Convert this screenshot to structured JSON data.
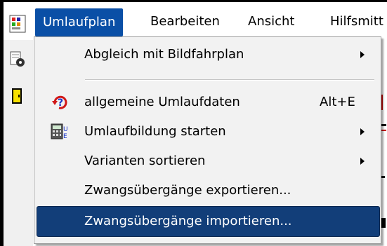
{
  "menubar": {
    "items": [
      {
        "label": "Umlaufplan"
      },
      {
        "label": "Bearbeiten"
      },
      {
        "label": "Ansicht"
      },
      {
        "label": "Hilfsmitt"
      }
    ]
  },
  "menu": {
    "items": [
      {
        "label": "Abgleich mit Bildfahrplan",
        "submenu": true
      },
      {
        "label": "allgemeine Umlaufdaten",
        "shortcut": "Alt+E",
        "icon": "help-refresh-icon"
      },
      {
        "label": "Umlaufbildung starten",
        "submenu": true,
        "icon": "calculator-icon"
      },
      {
        "label": "Varianten sortieren",
        "submenu": true
      },
      {
        "label": "Zwangsübergänge exportieren..."
      },
      {
        "label": "Zwangsübergänge importieren...",
        "highlighted": true
      }
    ]
  },
  "colors": {
    "menubar_active": "#0a4fa6",
    "menu_highlight": "#123e79",
    "menu_background": "#f2f2f2"
  }
}
